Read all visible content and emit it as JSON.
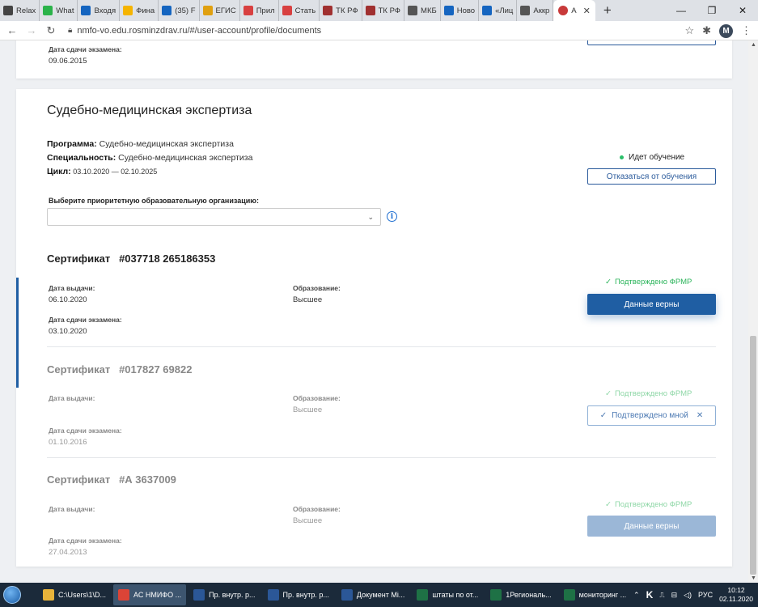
{
  "browser": {
    "tabs": [
      {
        "label": "Relax",
        "color": "#444444"
      },
      {
        "label": "What",
        "color": "#2bb34a"
      },
      {
        "label": "Входя",
        "color": "#1565c0"
      },
      {
        "label": "Фина",
        "color": "#f5b400"
      },
      {
        "label": "(35) F",
        "color": "#1565c0"
      },
      {
        "label": "ЕГИС",
        "color": "#e0a010"
      },
      {
        "label": "Прил",
        "color": "#d84040"
      },
      {
        "label": "Стать",
        "color": "#d84040"
      },
      {
        "label": "ТК РФ",
        "color": "#a03030"
      },
      {
        "label": "ТК РФ",
        "color": "#a03030"
      },
      {
        "label": "МКБ",
        "color": "#555555"
      },
      {
        "label": "Ново",
        "color": "#1565c0"
      },
      {
        "label": "«Лиц",
        "color": "#1565c0"
      },
      {
        "label": "Аккр",
        "color": "#555555"
      }
    ],
    "active_tab": {
      "label": "А",
      "color": "#c83a3a"
    },
    "new_tab": "+",
    "window_controls": {
      "minimize": "—",
      "maximize": "❐",
      "close": "✕"
    },
    "url": "nmfo-vo.edu.rosminzdrav.ru/#/user-account/profile/documents",
    "profile_initial": "M"
  },
  "top_card": {
    "exam_date_label": "Дата сдачи экзамена:",
    "exam_date": "09.06.2015"
  },
  "specialty": {
    "title": "Судебно-медицинская экспертиза",
    "program_label": "Программа:",
    "program": "Судебно-медицинская экспертиза",
    "specialty_label": "Специальность:",
    "specialty": "Судебно-медицинская экспертиза",
    "cycle_label": "Цикл:",
    "cycle": "03.10.2020 — 02.10.2025",
    "status": "Идет обучение",
    "withdraw_button": "Отказаться от обучения",
    "org_select_label": "Выберите приоритетную образовательную организацию:",
    "org_select_value": ""
  },
  "certificates": [
    {
      "title": "Сертификат",
      "number": "#037718 265186353",
      "issue_label": "Дата выдачи:",
      "issue_date": "06.10.2020",
      "education_label": "Образование:",
      "education": "Высшее",
      "exam_label": "Дата сдачи экзамена:",
      "exam_date": "03.10.2020",
      "frmr": "Подтверждено ФРМР",
      "action": "Данные верны"
    },
    {
      "title": "Сертификат",
      "number": "#017827 69822",
      "issue_label": "Дата выдачи:",
      "issue_date": "",
      "education_label": "Образование:",
      "education": "Высшее",
      "exam_label": "Дата сдачи экзамена:",
      "exam_date": "01.10.2016",
      "frmr": "Подтверждено ФРМР",
      "action": "Подтверждено мной"
    },
    {
      "title": "Сертификат",
      "number": "#А 3637009",
      "issue_label": "Дата выдачи:",
      "issue_date": "",
      "education_label": "Образование:",
      "education": "Высшее",
      "exam_label": "Дата сдачи экзамена:",
      "exam_date": "27.04.2013",
      "frmr": "Подтверждено ФРМР",
      "action": "Данные верны"
    }
  ],
  "taskbar": {
    "items": [
      {
        "label": "C:\\Users\\1\\D...",
        "icon": "folder-icon",
        "color": "#e8b33a"
      },
      {
        "label": "АС НМИФО ...",
        "icon": "chrome-icon",
        "color": "#db4437"
      },
      {
        "label": "Пр. внутр. р...",
        "icon": "word-icon",
        "color": "#2b5797"
      },
      {
        "label": "Пр. внутр. р...",
        "icon": "word-icon",
        "color": "#2b5797"
      },
      {
        "label": "Документ Mi...",
        "icon": "word-icon",
        "color": "#2b5797"
      },
      {
        "label": "штаты по от...",
        "icon": "excel-icon",
        "color": "#1e7145"
      },
      {
        "label": "1Региональ...",
        "icon": "excel-icon",
        "color": "#1e7145"
      },
      {
        "label": "мониторинг ...",
        "icon": "excel-icon",
        "color": "#1e7145"
      }
    ],
    "lang": "РУС",
    "time": "10:12",
    "date": "02.11.2020"
  }
}
